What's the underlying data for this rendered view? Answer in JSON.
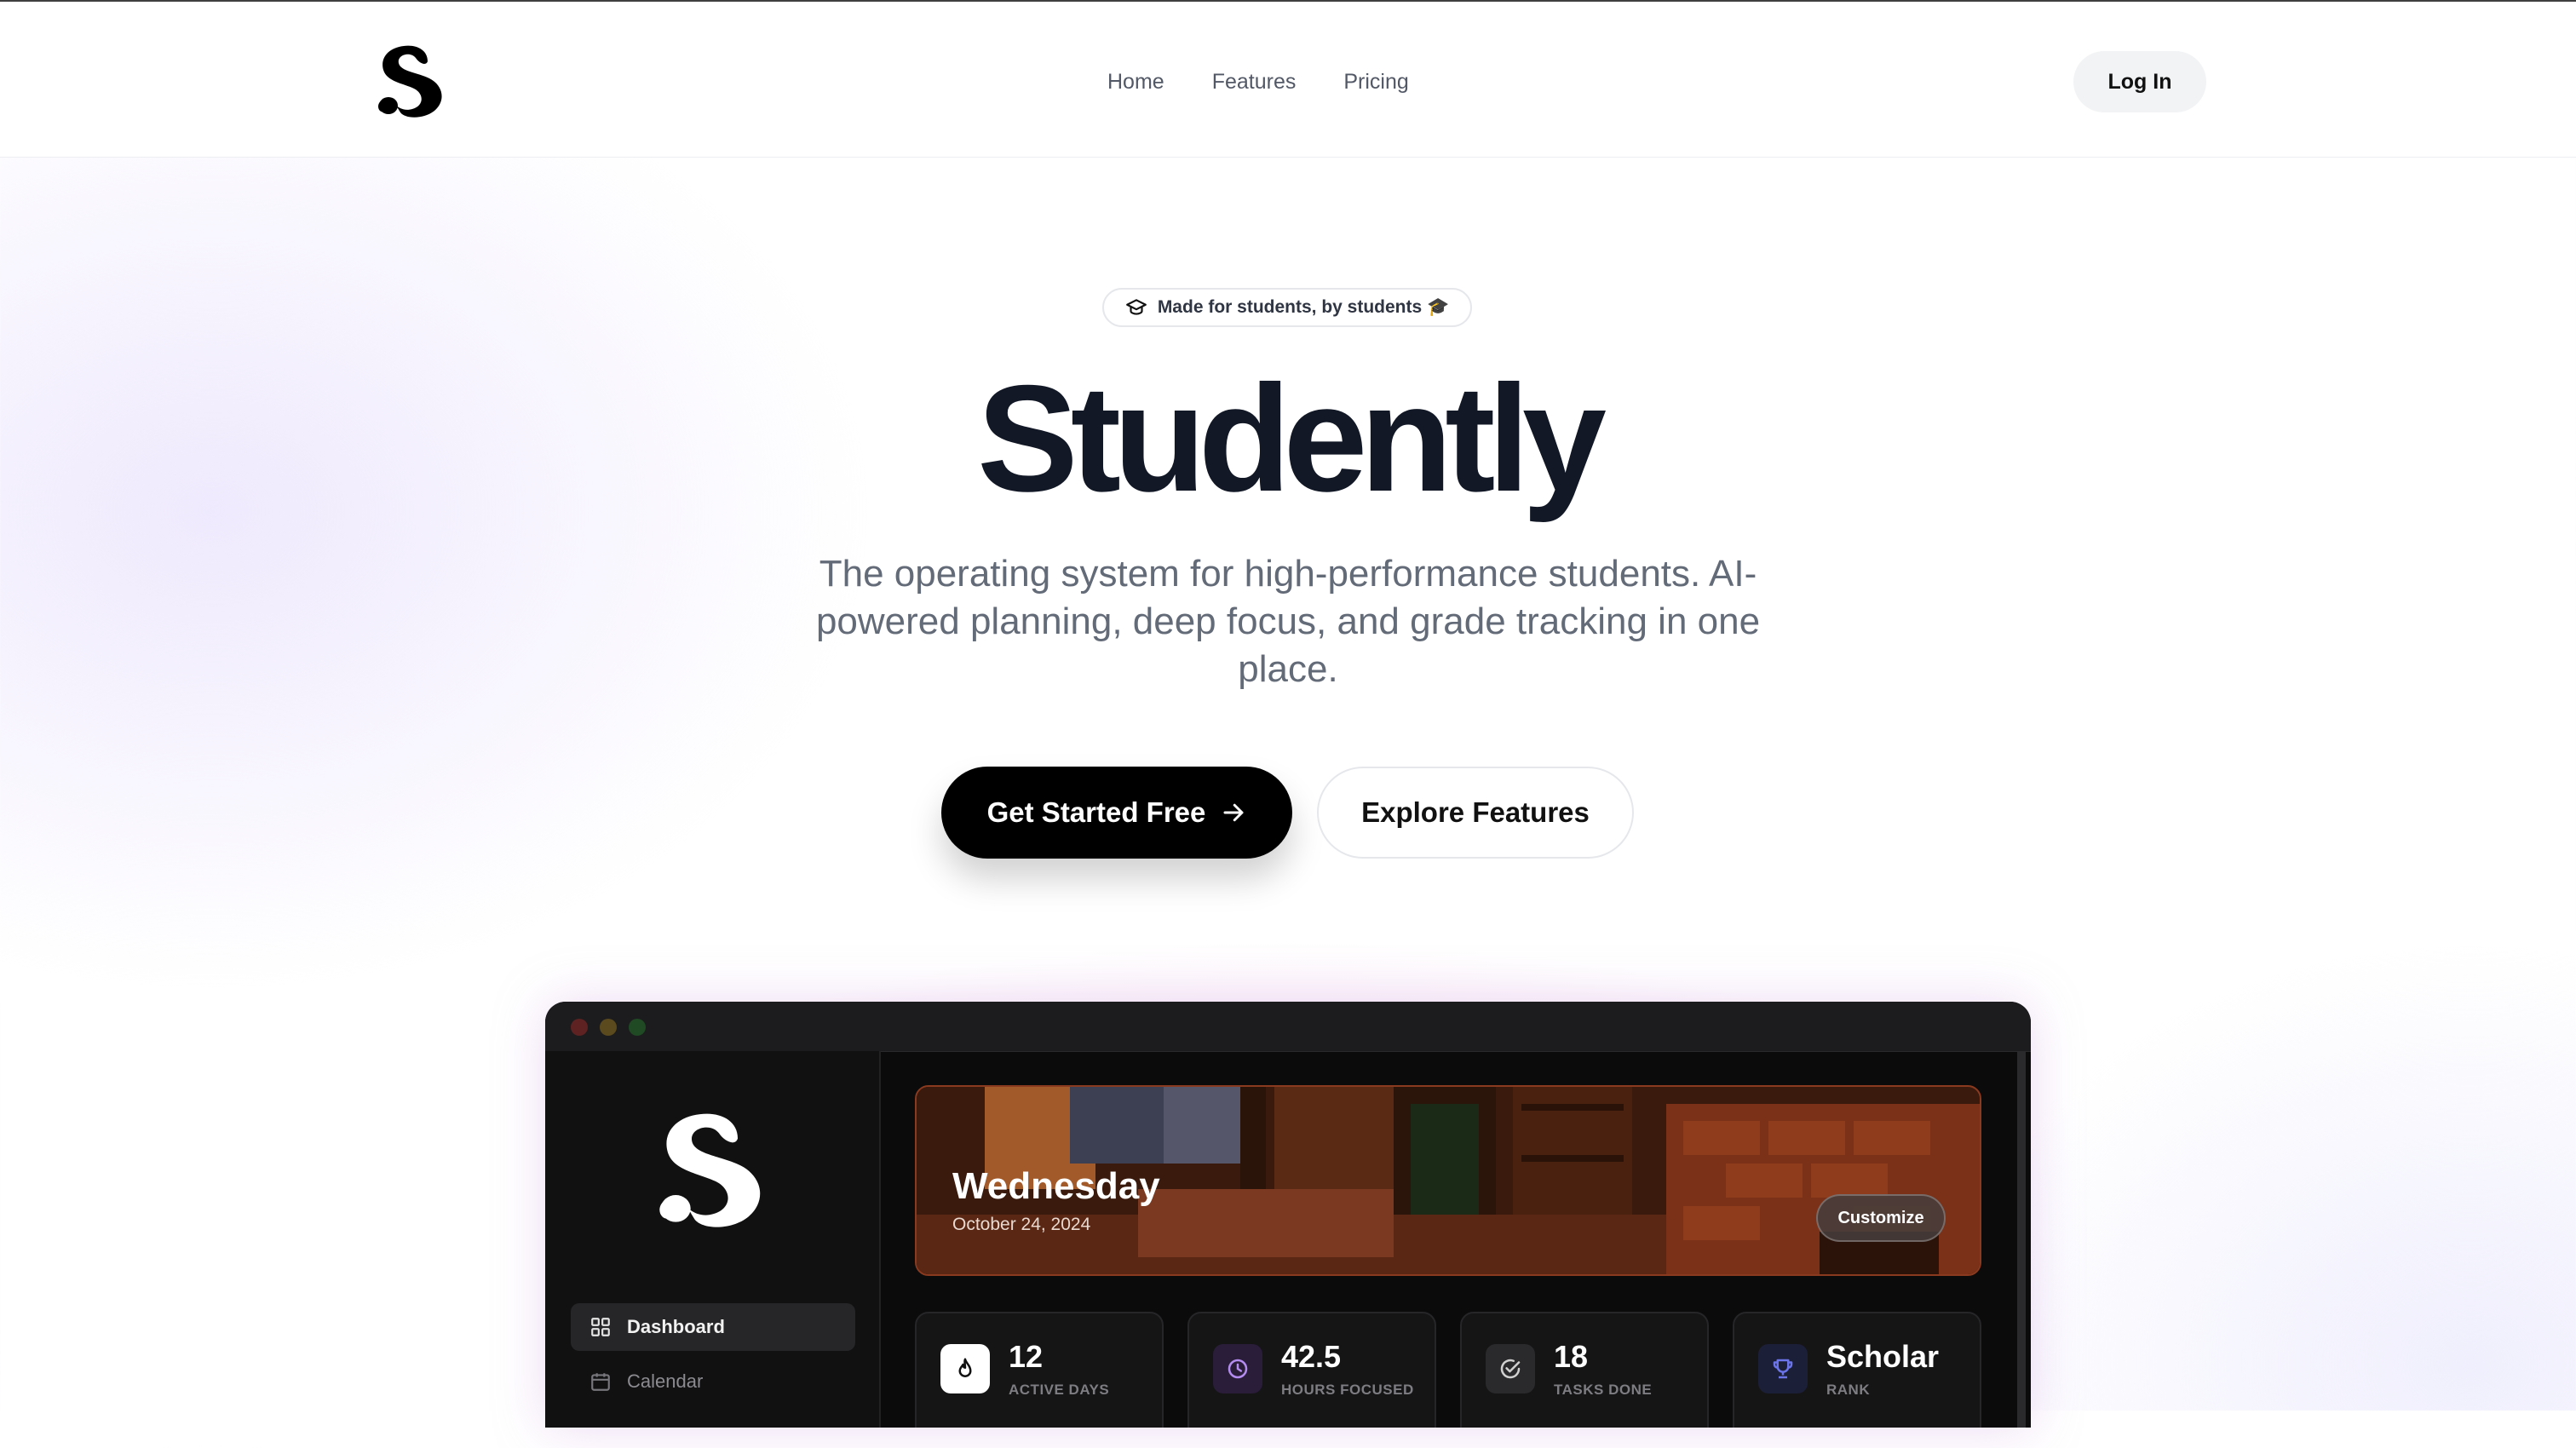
{
  "nav": {
    "links": [
      "Home",
      "Features",
      "Pricing"
    ],
    "login_label": "Log In"
  },
  "hero": {
    "badge": "Made for students, by students 🎓",
    "title": "Studently",
    "subtitle": "The operating system for high-performance students. AI-powered planning, deep focus, and grade tracking in one place.",
    "primary_cta": "Get Started Free",
    "secondary_cta": "Explore Features"
  },
  "preview": {
    "sidebar": {
      "items": [
        "Dashboard",
        "Calendar"
      ],
      "active": "Dashboard"
    },
    "banner": {
      "day": "Wednesday",
      "date": "October 24, 2024",
      "customize_label": "Customize"
    },
    "stats": [
      {
        "value": "12",
        "label": "ACTIVE DAYS",
        "icon": "flame-icon"
      },
      {
        "value": "42.5",
        "label": "HOURS FOCUSED",
        "icon": "clock-icon"
      },
      {
        "value": "18",
        "label": "TASKS DONE",
        "icon": "check-circle-icon"
      },
      {
        "value": "Scholar",
        "label": "RANK",
        "icon": "trophy-icon"
      }
    ]
  },
  "colors": {
    "primary": "#000000",
    "text": "#121826",
    "muted": "#646b78",
    "app_bg": "#0b0b0c",
    "traffic_red": "#5e2222",
    "traffic_yellow": "#5a4a1e",
    "traffic_green": "#1f4a24"
  }
}
